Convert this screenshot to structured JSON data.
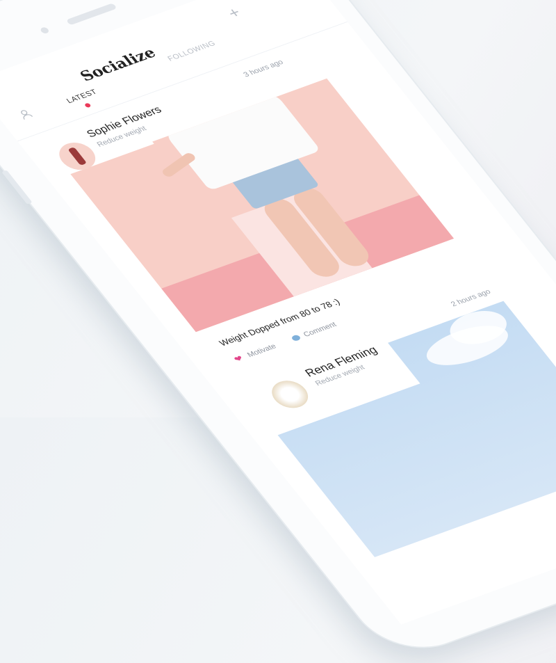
{
  "app": {
    "title": "Socialize",
    "add_icon": "plus-icon",
    "profile_icon": "user-icon"
  },
  "tabs": [
    {
      "label": "LATEST",
      "active": true
    },
    {
      "label": "FOLLOWING",
      "active": false
    }
  ],
  "accent_color": "#ea3a5a",
  "posts": [
    {
      "name": "Sophie Flowers",
      "goal": "Reduce weight",
      "time": "3 hours ago",
      "caption": "Weight Dopped from 80 to 78 :)",
      "actions": {
        "motivate": "Motivate",
        "comment": "Comment"
      }
    },
    {
      "name": "Rena Fleming",
      "goal": "Reduce weight",
      "time": "2 hours ago"
    }
  ]
}
